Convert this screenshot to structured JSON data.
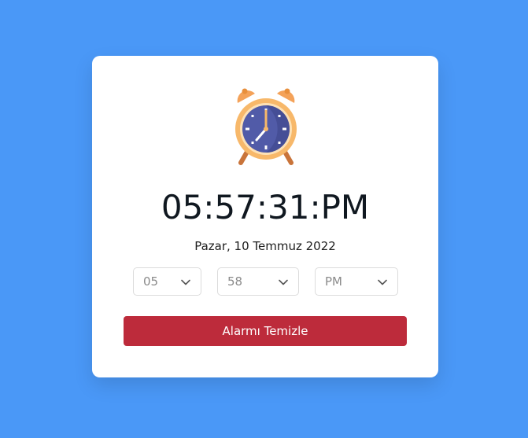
{
  "clock": {
    "time": "05:57:31:PM",
    "date": "Pazar, 10 Temmuz 2022",
    "icon": "alarm-clock-icon"
  },
  "selects": {
    "hour": "05",
    "minute": "58",
    "ampm": "PM"
  },
  "button": {
    "label": "Alarmı Temizle"
  },
  "colors": {
    "background": "#4a98f7",
    "card": "#ffffff",
    "button": "#bd2b3b",
    "clock_face": "#515ba8",
    "clock_frame": "#f7b86a"
  }
}
